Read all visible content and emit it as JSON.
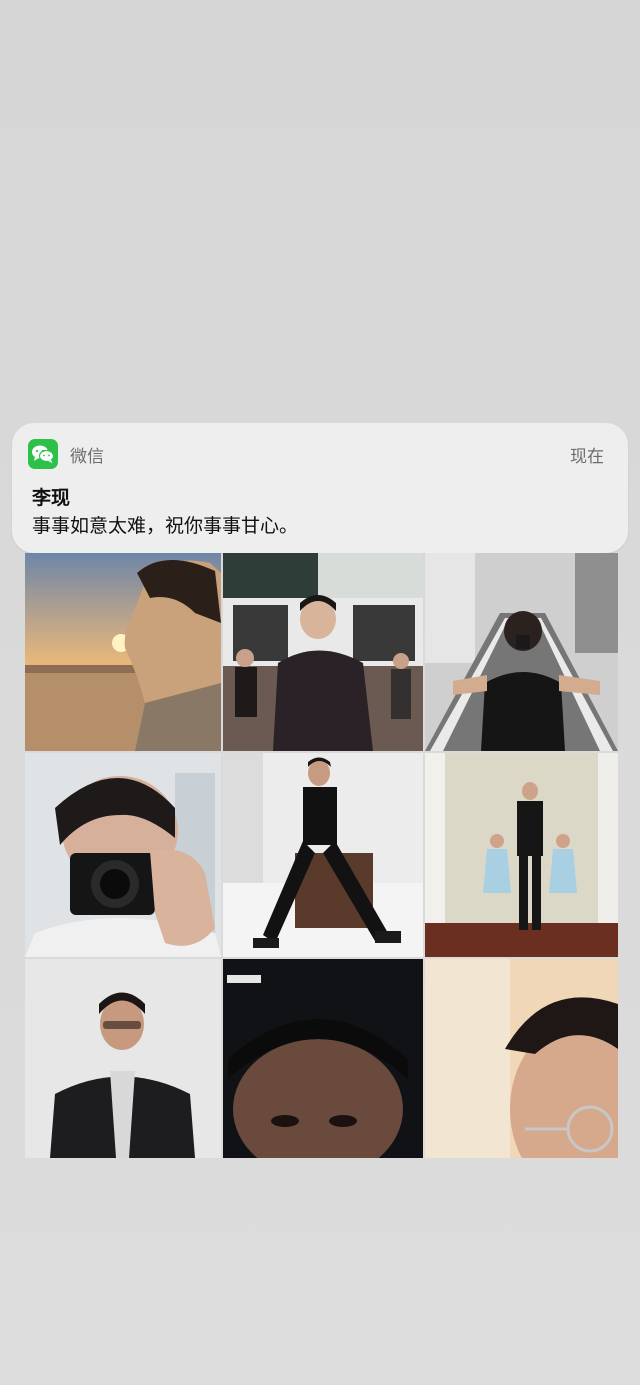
{
  "notification": {
    "app_icon": "wechat-icon",
    "app_name": "微信",
    "time": "现在",
    "sender": "李现",
    "message": "事事如意太难，祝你事事甘心。"
  },
  "photos": [
    {
      "name": "photo-sunset-profile"
    },
    {
      "name": "photo-street-sign"
    },
    {
      "name": "photo-street-camera"
    },
    {
      "name": "photo-mirror-camera"
    },
    {
      "name": "photo-sitting-white-room"
    },
    {
      "name": "photo-twins-hallway"
    },
    {
      "name": "photo-leather-jacket"
    },
    {
      "name": "photo-dark-selfie"
    },
    {
      "name": "photo-glasses-closeup"
    }
  ],
  "colors": {
    "wechat_green": "#2dc14a",
    "background": "#d8d8d8"
  }
}
